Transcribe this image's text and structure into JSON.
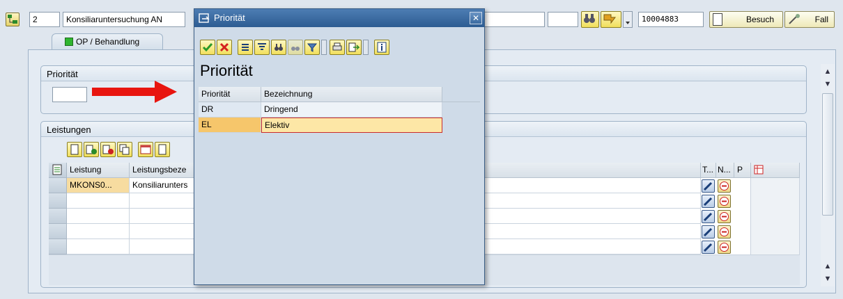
{
  "header": {
    "number": "2",
    "title_field": "Konsiliaruntersuchung AN",
    "patient_id": "10004883",
    "visit_button": "Besuch",
    "case_button": "Fall"
  },
  "tabs": [
    {
      "label": "OP / Behandlung"
    }
  ],
  "priority_frame": {
    "title": "Priorität",
    "value": ""
  },
  "services_frame": {
    "title": "Leistungen",
    "columns": [
      "Leistung",
      "Leistungsbeze",
      "T...",
      "N...",
      "P"
    ],
    "rows": [
      {
        "leistung": "MKONS0...",
        "bezeichnung": "Konsiliarunters"
      },
      {
        "leistung": "",
        "bezeichnung": ""
      },
      {
        "leistung": "",
        "bezeichnung": ""
      },
      {
        "leistung": "",
        "bezeichnung": ""
      },
      {
        "leistung": "",
        "bezeichnung": ""
      }
    ]
  },
  "dialog": {
    "title": "Priorität",
    "heading": "Priorität",
    "columns": [
      "Priorität",
      "Bezeichnung"
    ],
    "rows": [
      {
        "code": "DR",
        "text": "Dringend",
        "selected": false
      },
      {
        "code": "EL",
        "text": "Elektiv",
        "selected": true
      }
    ],
    "close_icon": "close-icon"
  },
  "colors": {
    "accent_arrow": "#e8150f",
    "selection_row": "#f6c66b",
    "dialog_title": "#2d5c92"
  }
}
